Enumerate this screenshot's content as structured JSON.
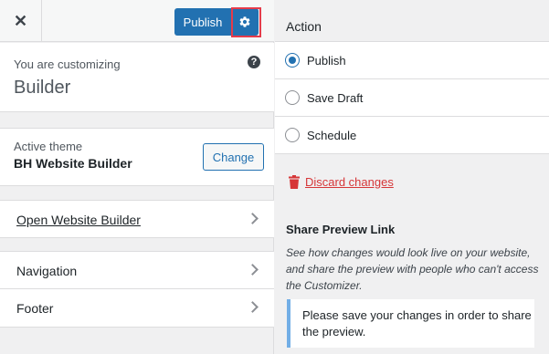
{
  "header": {
    "close_glyph": "✕",
    "publish_label": "Publish"
  },
  "customizing": {
    "lead": "You are customizing",
    "title": "Builder"
  },
  "theme": {
    "lead": "Active theme",
    "name": "BH Website Builder",
    "change_label": "Change"
  },
  "nav": {
    "open_builder": "Open Website Builder",
    "navigation": "Navigation",
    "footer": "Footer"
  },
  "action": {
    "title": "Action",
    "options": [
      {
        "label": "Publish",
        "selected": true
      },
      {
        "label": "Save Draft",
        "selected": false
      },
      {
        "label": "Schedule",
        "selected": false
      }
    ],
    "discard_label": "Discard changes"
  },
  "share": {
    "title": "Share Preview Link",
    "description": "See how changes would look live on your website, and share the preview with people who can't access the Customizer.",
    "notice": "Please save your changes in order to share the preview."
  },
  "colors": {
    "primary": "#2271b1",
    "danger": "#d63638",
    "highlight": "#e53b4a",
    "notice_border": "#72aee6"
  },
  "icons": [
    "close-icon",
    "gear-icon",
    "help-icon",
    "chevron-right-icon",
    "trash-icon"
  ]
}
